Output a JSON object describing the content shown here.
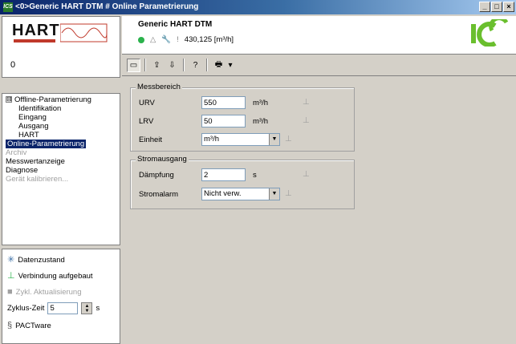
{
  "window": {
    "title": "<0>Generic HART DTM # Online Parametrierung",
    "app_icon": "ICS",
    "buttons": [
      "_",
      "□",
      "×"
    ]
  },
  "sidebar": {
    "logo": {
      "text": "HART"
    },
    "counter": "0",
    "tree": [
      {
        "label": "Offline-Parametrierung",
        "expander": "⊟"
      },
      {
        "label": "Identifikation"
      },
      {
        "label": "Eingang"
      },
      {
        "label": "Ausgang"
      },
      {
        "label": "HART"
      },
      {
        "label": "Online-Parametrierung"
      },
      {
        "label": "Archiv"
      },
      {
        "label": "Messwertanzeige"
      },
      {
        "label": "Diagnose"
      },
      {
        "label": "Gerät kalibrieren..."
      }
    ],
    "status": {
      "data_state": "Datenzustand",
      "connection": "Verbindung aufgebaut",
      "cyclic_update": "Zykl. Aktualisierung",
      "cycle_time_label": "Zyklus-Zeit",
      "cycle_time_value": "5",
      "cycle_time_unit": "s",
      "pactware": "PACTware"
    }
  },
  "header": {
    "device_name": "Generic HART DTM",
    "measured_value": "430,125 [m³/h]",
    "status_color": "#2bb24c"
  },
  "toolbar": {
    "icons": [
      "frame-icon",
      "upload-icon",
      "download-icon",
      "help-icon",
      "print-icon"
    ],
    "dropdown_arrow": "▾"
  },
  "messbereich": {
    "title": "Messbereich",
    "urv_label": "URV",
    "urv_value": "550",
    "urv_unit": "m³/h",
    "lrv_label": "LRV",
    "lrv_value": "50",
    "lrv_unit": "m³/h",
    "einheit_label": "Einheit",
    "einheit_value": "m³/h"
  },
  "stromausgang": {
    "title": "Stromausgang",
    "daempfung_label": "Dämpfung",
    "daempfung_value": "2",
    "daempfung_unit": "s",
    "stromalarm_label": "Stromalarm",
    "stromalarm_value": "Nicht verw."
  },
  "colors": {
    "title_bar": "#0a246a",
    "selection": "#0a246a",
    "logo_green": "#6abf2e",
    "panel_bg": "#d4d0c8"
  }
}
